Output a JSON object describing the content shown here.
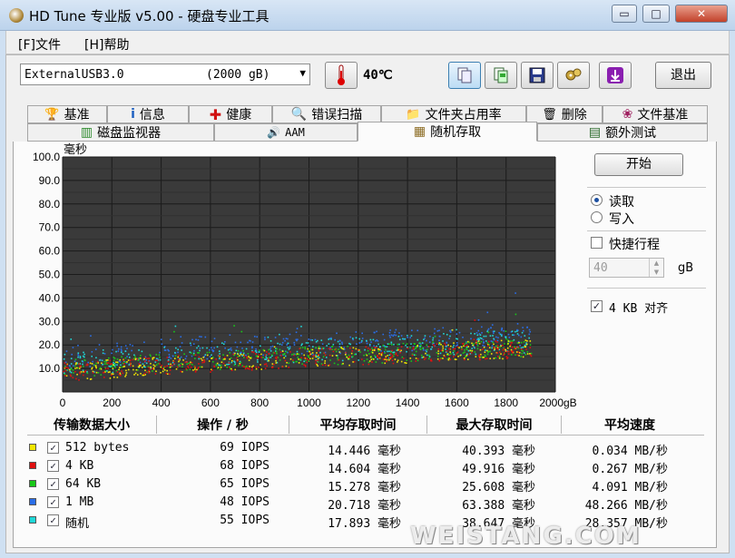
{
  "window": {
    "title": "HD Tune 专业版 v5.00 - 硬盘专业工具",
    "minimize_glyph": "▭",
    "maximize_glyph": "□",
    "close_glyph": "✕"
  },
  "menu": [
    {
      "label": "[F]文件"
    },
    {
      "label": "[H]帮助"
    }
  ],
  "toolbar": {
    "drive_name": "ExternalUSB3.0",
    "drive_size": "(2000 gB)",
    "dropdown_arrow": "▼",
    "temperature": "40℃",
    "exit_label": "退出",
    "icons": [
      "thermometer-icon",
      "copy-text-icon",
      "copy-screen-icon",
      "save-icon",
      "options-icon",
      "download-icon"
    ]
  },
  "tabs_row1": [
    "基准",
    "信息",
    "健康",
    "错误扫描",
    "文件夹占用率",
    "删除",
    "文件基准"
  ],
  "tabs_row2": [
    "磁盘监视器",
    "AAM",
    "随机存取",
    "额外测试"
  ],
  "active_tab": "随机存取",
  "controls": {
    "start_label": "开始",
    "read_label": "读取",
    "write_label": "写入",
    "read_selected": true,
    "quick_label": "快捷行程",
    "quick_checked": false,
    "quick_value": "40",
    "quick_unit": "gB",
    "align_label": "4 KB 对齐",
    "align_checked": true
  },
  "table": {
    "headers": [
      "传输数据大小",
      "操作 / 秒",
      "平均存取时间",
      "最大存取时间",
      "平均速度"
    ],
    "rows": [
      {
        "color": "#f2e600",
        "name": "512 bytes",
        "ops": "69 IOPS",
        "avg": "14.446 毫秒",
        "max": "40.393 毫秒",
        "speed": "0.034 MB/秒",
        "checked": true
      },
      {
        "color": "#e01010",
        "name": "4 KB",
        "ops": "68 IOPS",
        "avg": "14.604 毫秒",
        "max": "49.916 毫秒",
        "speed": "0.267 MB/秒",
        "checked": true
      },
      {
        "color": "#18c818",
        "name": "64 KB",
        "ops": "65 IOPS",
        "avg": "15.278 毫秒",
        "max": "25.608 毫秒",
        "speed": "4.091 MB/秒",
        "checked": true
      },
      {
        "color": "#2a6ee8",
        "name": "1 MB",
        "ops": "48 IOPS",
        "avg": "20.718 毫秒",
        "max": "63.388 毫秒",
        "speed": "48.266 MB/秒",
        "checked": true
      },
      {
        "color": "#20d8d8",
        "name": "随机",
        "ops": "55 IOPS",
        "avg": "17.893 毫秒",
        "max": "38.647 毫秒",
        "speed": "28.357 MB/秒",
        "checked": true
      }
    ]
  },
  "watermark": "WEISTANG.COM",
  "chart_data": {
    "type": "scatter",
    "ylabel": "毫秒",
    "xunit": "gB",
    "xlim": [
      0,
      2000
    ],
    "ylim": [
      0,
      100
    ],
    "xticks": [
      "0",
      "200",
      "400",
      "600",
      "800",
      "1000",
      "1200",
      "1400",
      "1600",
      "1800",
      "2000gB"
    ],
    "yticks": [
      "100.0",
      "90.0",
      "80.0",
      "70.0",
      "60.0",
      "50.0",
      "40.0",
      "30.0",
      "20.0",
      "10.0"
    ],
    "grid": true,
    "series": [
      {
        "name": "512 bytes",
        "color": "#f2e600",
        "trend": [
          [
            0,
            9
          ],
          [
            500,
            12
          ],
          [
            1000,
            15
          ],
          [
            1500,
            17
          ],
          [
            1900,
            19
          ]
        ],
        "spread": 4
      },
      {
        "name": "4 KB",
        "color": "#e01010",
        "trend": [
          [
            0,
            9
          ],
          [
            500,
            12
          ],
          [
            1000,
            15
          ],
          [
            1500,
            17
          ],
          [
            1900,
            19
          ]
        ],
        "spread": 4
      },
      {
        "name": "64 KB",
        "color": "#18c818",
        "trend": [
          [
            0,
            10
          ],
          [
            500,
            13
          ],
          [
            1000,
            15.5
          ],
          [
            1500,
            17.5
          ],
          [
            1900,
            19.5
          ]
        ],
        "spread": 4
      },
      {
        "name": "1 MB",
        "color": "#2a6ee8",
        "trend": [
          [
            0,
            15
          ],
          [
            500,
            19
          ],
          [
            1000,
            21
          ],
          [
            1500,
            23
          ],
          [
            1900,
            25
          ]
        ],
        "spread": 5
      },
      {
        "name": "随机",
        "color": "#20d8d8",
        "trend": [
          [
            0,
            12
          ],
          [
            500,
            16
          ],
          [
            1000,
            18
          ],
          [
            1500,
            20
          ],
          [
            1900,
            22
          ]
        ],
        "spread": 5
      }
    ]
  }
}
